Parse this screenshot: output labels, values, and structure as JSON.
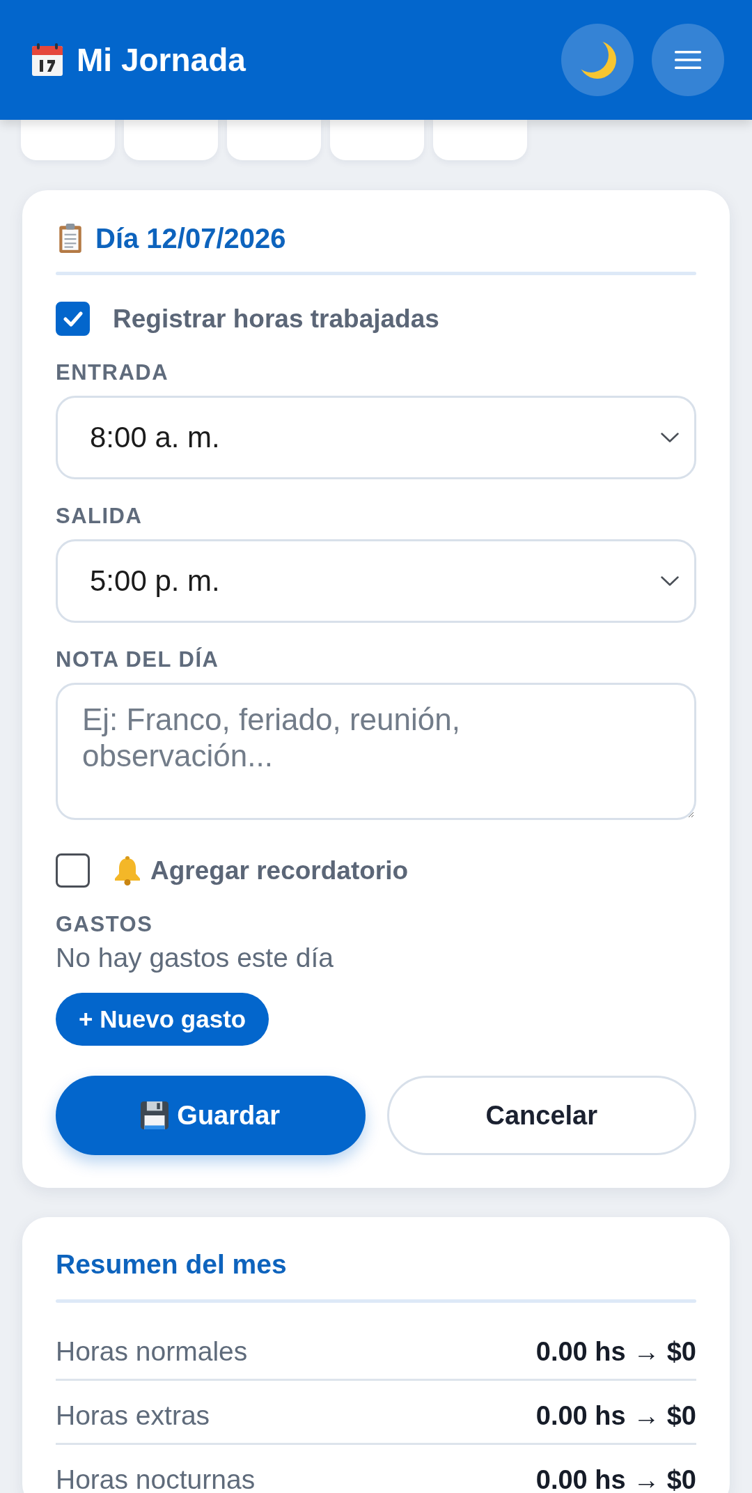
{
  "header": {
    "title": "Mi Jornada"
  },
  "day_editor": {
    "title": "Día 12/07/2026",
    "register_hours": {
      "label": "Registrar horas trabajadas",
      "checked": true
    },
    "fields": [
      {
        "kind": "select",
        "label": "ENTRADA",
        "value": "8:00 a. m."
      },
      {
        "kind": "select",
        "label": "SALIDA",
        "value": "5:00 p. m."
      },
      {
        "kind": "textarea",
        "label": "NOTA DEL DÍA",
        "placeholder": "Ej: Franco, feriado, reunión, observación..."
      }
    ],
    "reminder": {
      "label": "Agregar recordatorio",
      "checked": false
    },
    "expenses": {
      "label": "GASTOS",
      "empty_text": "No hay gastos este día",
      "add_button": "+ Nuevo gasto"
    },
    "buttons": [
      {
        "kind": "save",
        "label": "Guardar"
      },
      {
        "kind": "cancel",
        "label": "Cancelar"
      }
    ]
  },
  "summary": {
    "title": "Resumen del mes",
    "rows": [
      {
        "label": "Horas normales",
        "value": "0.00 hs → $0"
      },
      {
        "label": "Horas extras",
        "value": "0.00 hs → $0"
      },
      {
        "label": "Horas nocturnas",
        "value": "0.00 hs → $0"
      }
    ]
  }
}
